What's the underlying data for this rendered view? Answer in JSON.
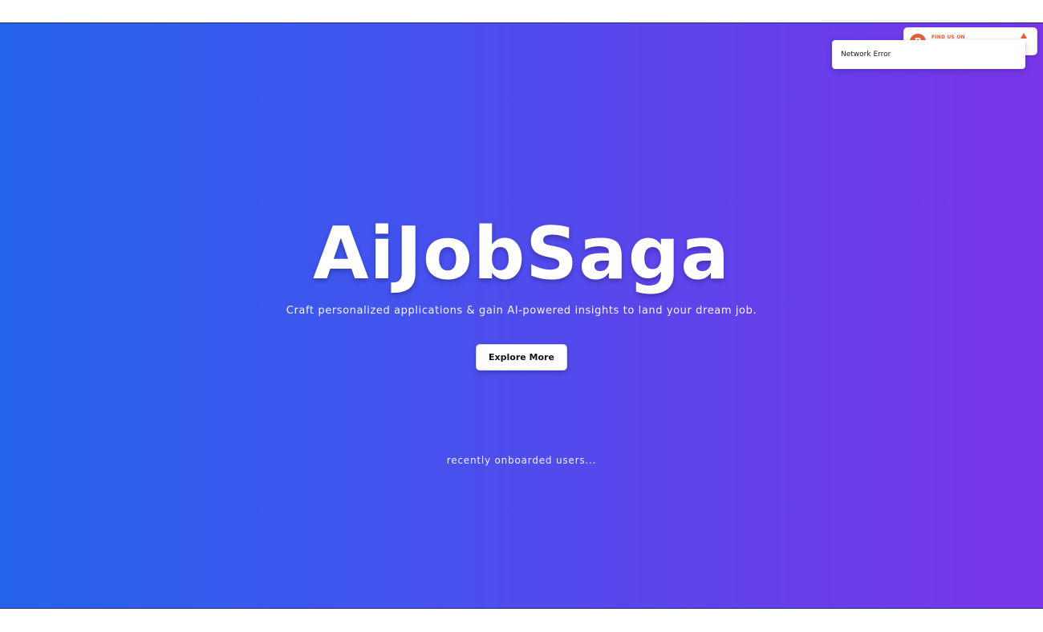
{
  "hero": {
    "title": "AiJobSaga",
    "subtitle": "Craft personalized applications & gain AI-powered insights to land your dream job.",
    "cta_label": "Explore More",
    "recent_users": "recently onboarded users..."
  },
  "badge": {
    "label": "FIND US ON",
    "logo_letter": "P",
    "icon": "upvote-triangle-icon",
    "count": "3"
  },
  "toast": {
    "message": "Network Error"
  },
  "colors": {
    "gradient_start": "#2563eb",
    "gradient_end": "#7a35e9",
    "badge_accent": "#ea5a3c"
  }
}
